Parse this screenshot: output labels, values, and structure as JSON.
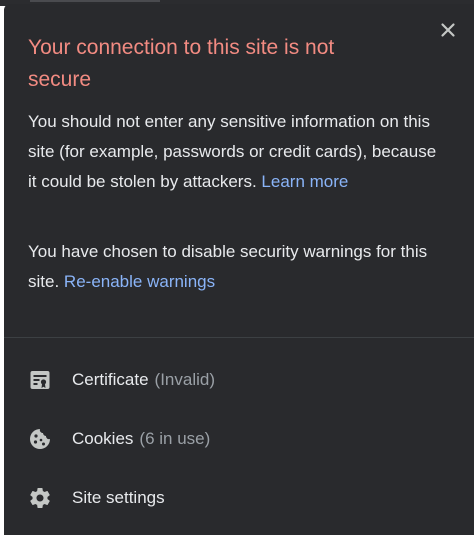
{
  "popup": {
    "title": "Your connection to this site is not secure",
    "warning_text": "You should not enter any sensitive information on this site (for example, passwords or credit cards), because it could be stolen by attackers.",
    "learn_more_link": "Learn more",
    "disabled_text": "You have chosen to disable security warnings for this site.",
    "reenable_link": "Re-enable warnings",
    "close_icon": "close-icon"
  },
  "rows": [
    {
      "label": "Certificate",
      "status": "(Invalid)",
      "icon": "certificate-icon"
    },
    {
      "label": "Cookies",
      "status": "(6 in use)",
      "icon": "cookie-icon"
    },
    {
      "label": "Site settings",
      "status": "",
      "icon": "gear-icon"
    }
  ],
  "colors": {
    "background": "#292a2d",
    "title": "#f28b82",
    "text": "#e8eaed",
    "link": "#8ab4f8",
    "muted": "#9aa0a6"
  }
}
